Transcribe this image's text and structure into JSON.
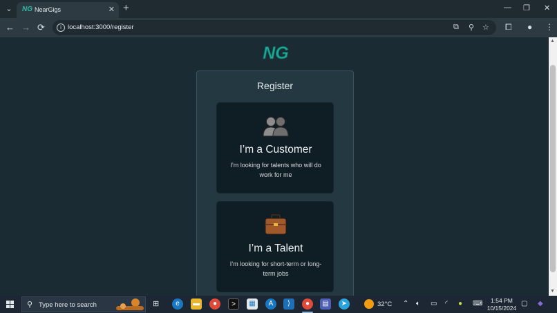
{
  "browser": {
    "tab_title": "NearGigs",
    "tab_favicon": "NG",
    "url": "localhost:3000/register",
    "new_tab_icon": "+",
    "close_tab_icon": "✕",
    "minimize_icon": "—",
    "restore_icon": "❐",
    "close_window_icon": "✕"
  },
  "page": {
    "logo_text": "NG",
    "title": "Register",
    "options": [
      {
        "icon": "people-icon",
        "title": "I’m a Customer",
        "description": "I’m looking for talents who will do work for me"
      },
      {
        "icon": "briefcase-icon",
        "title": "I’m a Talent",
        "description": "I’m looking for short-term or long-term jobs"
      }
    ]
  },
  "taskbar": {
    "search_placeholder": "Type here to search",
    "temperature": "32°C",
    "time": "1:54 PM",
    "date": "10/15/2024"
  },
  "colors": {
    "page_background": "#1b2b33",
    "card_background": "#243842",
    "option_background": "#0f1d24",
    "logo_teal": "#1ea897"
  }
}
